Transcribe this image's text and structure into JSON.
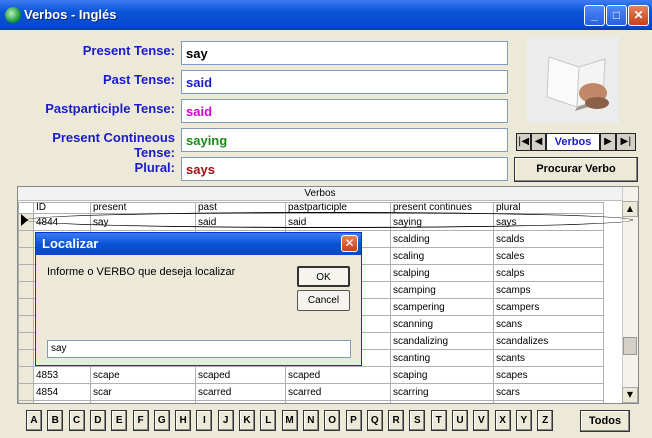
{
  "window": {
    "title": "Verbos - Inglés",
    "minimize": "_",
    "maximize": "□",
    "close": "✕"
  },
  "form": {
    "fields": [
      {
        "label": "Present Tense:",
        "value": "say",
        "color": "#000000"
      },
      {
        "label": "Past Tense:",
        "value": "said",
        "color": "#1a1acc"
      },
      {
        "label": "Pastparticiple Tense:",
        "value": "said",
        "color": "#d400d4"
      },
      {
        "label": "Present Contineous Tense:",
        "value": "saying",
        "color": "#1a8a1a"
      },
      {
        "label": "Plural:",
        "value": "says",
        "color": "#a01010"
      }
    ]
  },
  "navigator": {
    "first": "|◀",
    "prev": "◀",
    "label": "Verbos",
    "next": "▶",
    "last": "▶|"
  },
  "search_button": "Procurar Verbo",
  "grid": {
    "caption": "Verbos",
    "columns": [
      "ID",
      "present",
      "past",
      "pastparticiple",
      "present continues",
      "plural"
    ],
    "rows": [
      [
        "4844",
        "say",
        "said",
        "said",
        "saying",
        "says"
      ],
      [
        "",
        "",
        "",
        "",
        "scalding",
        "scalds"
      ],
      [
        "",
        "",
        "",
        "",
        "scaling",
        "scales"
      ],
      [
        "",
        "",
        "",
        "",
        "scalping",
        "scalps"
      ],
      [
        "",
        "",
        "",
        "",
        "scamping",
        "scamps"
      ],
      [
        "",
        "",
        "",
        "",
        "scampering",
        "scampers"
      ],
      [
        "",
        "",
        "",
        "",
        "scanning",
        "scans"
      ],
      [
        "",
        "",
        "",
        "",
        "scandalizing",
        "scandalizes"
      ],
      [
        "",
        "",
        "",
        "",
        "scanting",
        "scants"
      ],
      [
        "4853",
        "scape",
        "scaped",
        "scaped",
        "scaping",
        "scapes"
      ],
      [
        "4854",
        "scar",
        "scarred",
        "scarred",
        "scarring",
        "scars"
      ],
      [
        "4855",
        "scare",
        "scared",
        "scared",
        "scaring",
        "scares"
      ]
    ]
  },
  "dialog": {
    "title": "Localizar",
    "prompt": "Informe o VERBO que deseja localizar",
    "ok": "OK",
    "cancel": "Cancel",
    "input_value": "say",
    "close": "✕"
  },
  "alphabet": [
    "A",
    "B",
    "C",
    "D",
    "E",
    "F",
    "G",
    "H",
    "I",
    "J",
    "K",
    "L",
    "M",
    "N",
    "O",
    "P",
    "Q",
    "R",
    "S",
    "T",
    "U",
    "V",
    "X",
    "Y",
    "Z"
  ],
  "todos": "Todos"
}
